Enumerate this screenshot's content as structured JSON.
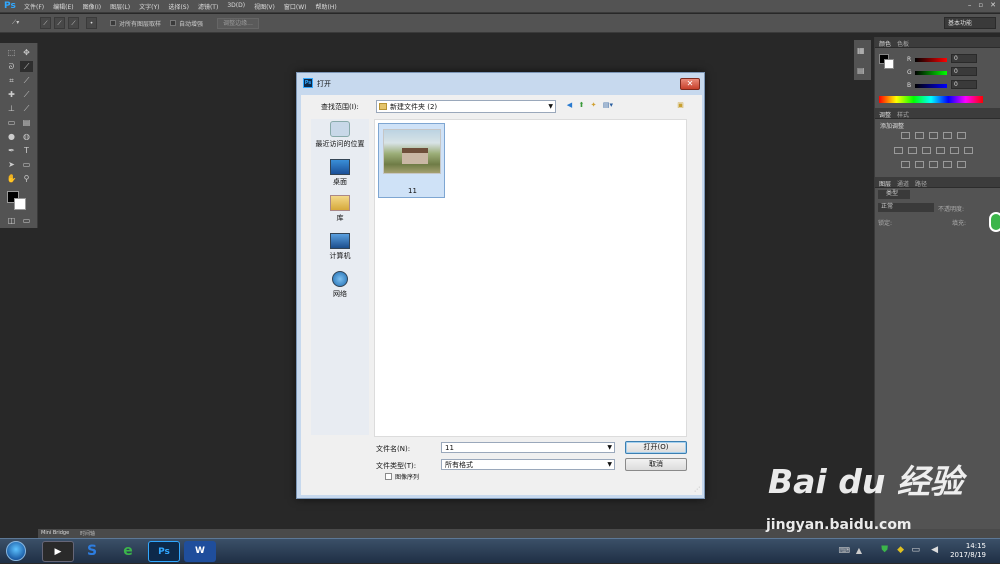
{
  "app": {
    "logo": "Ps"
  },
  "menubar": {
    "items": [
      "文件(F)",
      "编辑(E)",
      "图像(I)",
      "图层(L)",
      "文字(Y)",
      "选择(S)",
      "滤镜(T)",
      "3D(D)",
      "视图(V)",
      "窗口(W)",
      "帮助(H)"
    ]
  },
  "optionsbar": {
    "sample_all_layers": "对所有图层取样",
    "auto_enhance": "自动增强",
    "refine_edge": "调整边缘...",
    "workspace": "基本功能"
  },
  "color_panel": {
    "tabs": [
      "颜色",
      "色板"
    ],
    "r_label": "R",
    "g_label": "G",
    "b_label": "B",
    "r": "0",
    "g": "0",
    "b": "0"
  },
  "adjust_panel": {
    "tabs": [
      "调整",
      "样式"
    ],
    "add_adjustment": "添加调整"
  },
  "layers_panel": {
    "tabs": [
      "图层",
      "通道",
      "路径"
    ],
    "kind": "类型",
    "blend": "正常",
    "opacity_label": "不透明度:",
    "lock_label": "锁定:",
    "fill_label": "填充:"
  },
  "statusbar": {
    "tabs": [
      "Mini Bridge",
      "时间轴"
    ]
  },
  "dialog": {
    "title": "打开",
    "close": "✕",
    "look_in_label": "查找范围(I):",
    "look_in_value": "新建文件夹 (2)",
    "places": [
      "最近访问的位置",
      "桌面",
      "库",
      "计算机",
      "网络"
    ],
    "files": [
      {
        "name": "11"
      }
    ],
    "filename_label": "文件名(N):",
    "filename_value": "11",
    "filetype_label": "文件类型(T):",
    "filetype_value": "所有格式",
    "open_button": "打开(O)",
    "cancel_button": "取消",
    "image_sequence": "图像序列"
  },
  "taskbar": {
    "apps": [
      "Ps"
    ],
    "time": "14:15",
    "date": "2017/8/19"
  },
  "watermark": {
    "brand": "Bai du 经验",
    "url": "jingyan.baidu.com"
  }
}
